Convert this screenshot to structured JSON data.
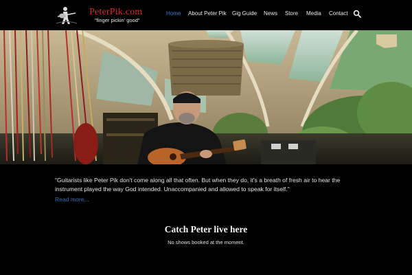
{
  "site": {
    "logo_name": "PeterPik.com",
    "logo_tagline": "\"finger pickin' good\"",
    "brand_color": "#e02424"
  },
  "nav": {
    "active_color": "#3b78c8",
    "items": [
      {
        "label": "Home",
        "active": true
      },
      {
        "label": "About Peter Pik",
        "active": false
      },
      {
        "label": "Gig Guide",
        "active": false
      },
      {
        "label": "News",
        "active": false
      },
      {
        "label": "Store",
        "active": false
      },
      {
        "label": "Media",
        "active": false
      },
      {
        "label": "Contact",
        "active": false
      }
    ],
    "search_icon": "search-icon"
  },
  "hero": {
    "image": "guitarist-playing-under-tent"
  },
  "quote": {
    "text": "\"Guitarists like Peter Pik don't come along all that often. But when they do, it's a breath of fresh air to hear the instrument played the way God intended. Unaccompanied and allowed to speak for itself.\"",
    "read_more": "Read more..."
  },
  "gigs": {
    "title": "Catch Peter live here",
    "empty_message": "No shows booked at the moment."
  }
}
